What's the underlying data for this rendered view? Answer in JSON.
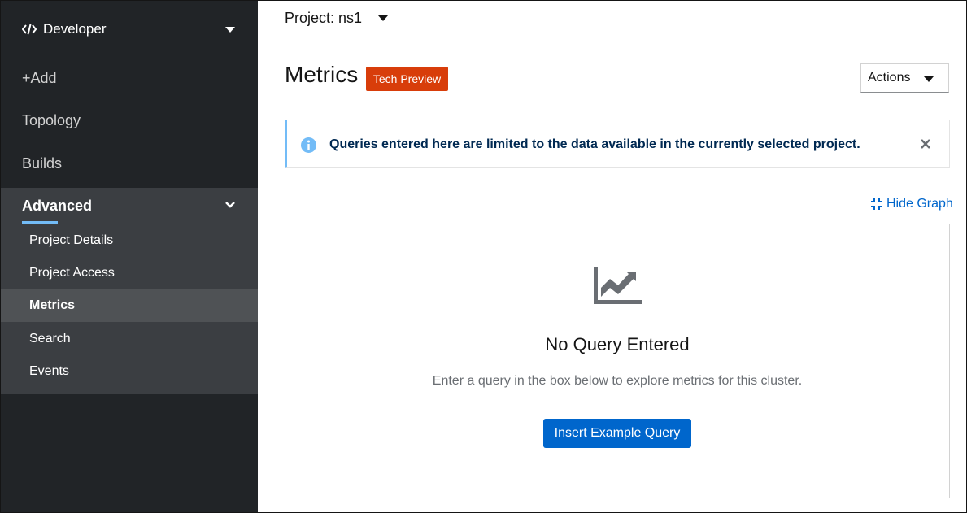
{
  "sidebar": {
    "perspective_label": "Developer",
    "items": [
      {
        "label": "+Add"
      },
      {
        "label": "Topology"
      },
      {
        "label": "Builds"
      }
    ],
    "advanced": {
      "label": "Advanced",
      "subitems": [
        {
          "label": "Project Details",
          "active": false
        },
        {
          "label": "Project Access",
          "active": false
        },
        {
          "label": "Metrics",
          "active": true
        },
        {
          "label": "Search",
          "active": false
        },
        {
          "label": "Events",
          "active": false
        }
      ]
    }
  },
  "topbar": {
    "project_label": "Project: ns1"
  },
  "page": {
    "title": "Metrics",
    "badge": "Tech Preview",
    "actions_label": "Actions"
  },
  "alert": {
    "message": "Queries entered here are limited to the data available in the currently selected project."
  },
  "graph": {
    "hide_label": "Hide Graph",
    "empty_title": "No Query Entered",
    "empty_body": "Enter a query in the box below to explore metrics for this cluster.",
    "insert_button": "Insert Example Query"
  },
  "colors": {
    "sidebar_bg": "#212427",
    "advanced_bg": "#3b3e42",
    "active_bg": "#4f5255",
    "badge_bg": "#d83d0a",
    "link_blue": "#0066cc",
    "alert_accent": "#73bcf7"
  },
  "icons": {
    "perspective": "code-icon",
    "alert": "info-circle-icon",
    "close": "close-icon",
    "hide_graph": "compress-icon",
    "empty_state": "area-chart-icon"
  }
}
